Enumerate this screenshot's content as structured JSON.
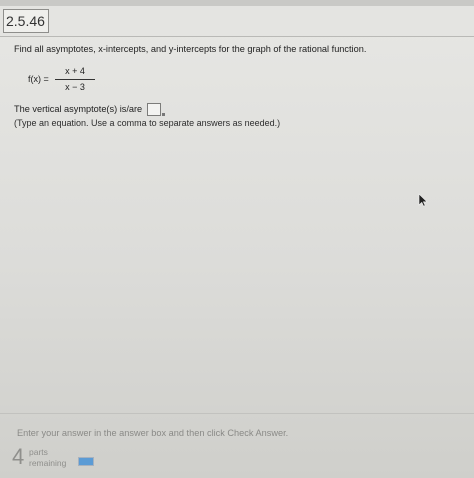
{
  "header": {
    "question_number": "2.5.46"
  },
  "problem": {
    "prompt": "Find all asymptotes, x-intercepts, and y-intercepts for the graph of the rational function.",
    "function": {
      "lhs": "f(x) =",
      "numerator": "x + 4",
      "denominator": "x − 3"
    },
    "answer_label": "The vertical asymptote(s) is/are",
    "answer_value": "",
    "hint": "(Type an equation. Use a comma to separate answers as needed.)"
  },
  "footer": {
    "instructions": "Enter your answer in the answer box and then click Check Answer.",
    "parts_count": "4",
    "parts_label_1": "parts",
    "parts_label_2": "remaining",
    "progress_fraction": 1.0
  },
  "colors": {
    "progress_fill": "#5b9bd5",
    "page_background": "#dcdcd9"
  },
  "icons": {
    "pointer": "mouse-pointer-icon"
  }
}
